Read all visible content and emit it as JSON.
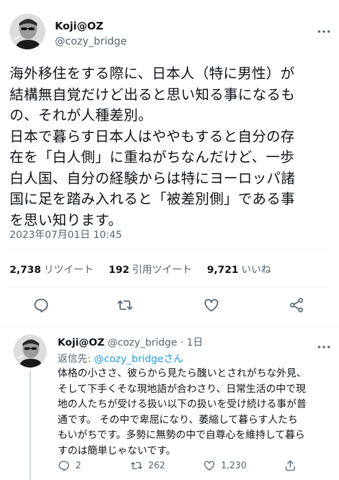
{
  "tweet": {
    "display_name": "Koji@OZ",
    "handle": "@cozy_bridge",
    "body": "海外移住をする際に、日本人（特に男性）が\n結構無自覚だけど出ると思い知る事になるも\nの、それが人種差別。\n日本で暮らす日本人はややもすると自分の存\n在を「白人側」に重ねがちなんだけど、一歩\n白人国、自分の経験からは特にヨーロッパ諸\n国に足を踏み入れると「被差別側」である事\nを思い知ります。",
    "timestamp": "2023年07月01日 10:45",
    "stats": [
      {
        "value": "2,738",
        "label": "リツイート"
      },
      {
        "value": "192",
        "label": "引用ツイート"
      },
      {
        "value": "9,721",
        "label": "いいね"
      }
    ],
    "actions": {
      "reply_icon": "reply-icon",
      "retweet_icon": "retweet-icon",
      "like_icon": "like-icon",
      "share_icon": "share-icon"
    }
  },
  "reply": {
    "display_name": "Koji@OZ",
    "handle": "@cozy_bridge",
    "time": "1日",
    "reply_to_label": "返信先: ",
    "reply_to_handle": "@cozy_bridgeさん",
    "body": "体格の小ささ、彼らから見たら醜いとされがちな外見、\nそして下手くそな現地語が合わさり、日常生活の中で現\n地の人たちが受ける扱い以下の扱いを受け続ける事が普\n通です。 その中で卑屈になり、萎縮して暮らす人たち\nもいがちです。多勢に無勢の中で自尊心を維持して暮ら\nすのは簡単じゃないです。",
    "counts": {
      "replies": "2",
      "retweets": "262",
      "likes": "1,230"
    }
  },
  "colors": {
    "text": "#0f1419",
    "secondary": "#536471",
    "link": "#1d9bf0",
    "divider": "#eff3f4"
  }
}
